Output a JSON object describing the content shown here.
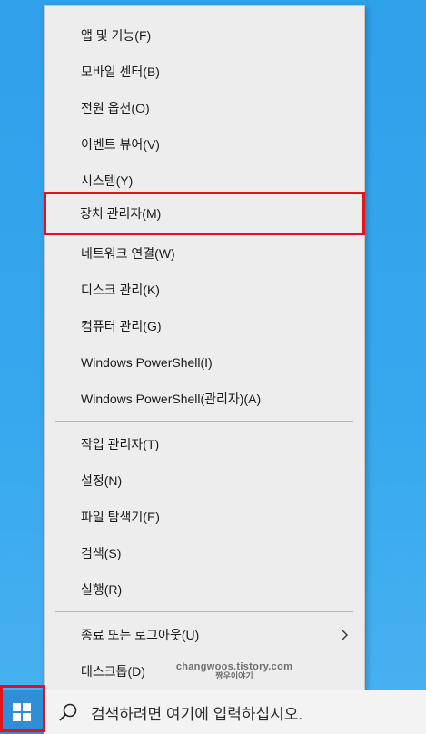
{
  "menu": {
    "items": [
      {
        "label": "앱 및 기능(F)"
      },
      {
        "label": "모바일 센터(B)"
      },
      {
        "label": "전원 옵션(O)"
      },
      {
        "label": "이벤트 뷰어(V)"
      },
      {
        "label": "시스템(Y)"
      },
      {
        "label": "장치 관리자(M)"
      },
      {
        "label": "네트워크 연결(W)"
      },
      {
        "label": "디스크 관리(K)"
      },
      {
        "label": "컴퓨터 관리(G)"
      },
      {
        "label": "Windows PowerShell(I)"
      },
      {
        "label": "Windows PowerShell(관리자)(A)"
      },
      {
        "label": "작업 관리자(T)"
      },
      {
        "label": "설정(N)"
      },
      {
        "label": "파일 탐색기(E)"
      },
      {
        "label": "검색(S)"
      },
      {
        "label": "실행(R)"
      },
      {
        "label": "종료 또는 로그아웃(U)",
        "submenu_icon": "chevron-right-icon"
      },
      {
        "label": "데스크톱(D)"
      }
    ]
  },
  "watermark": {
    "line1": "changwoos.tistory.com",
    "line2": "짱우이야기"
  },
  "taskbar": {
    "start_icon": "windows-logo-icon",
    "search_icon": "search-icon",
    "search_text": "검색하려면 여기에 입력하십시오."
  },
  "colors": {
    "highlight": "#e0141b",
    "start_button": "#2f8ed6",
    "desktop": "#36a8ee"
  }
}
